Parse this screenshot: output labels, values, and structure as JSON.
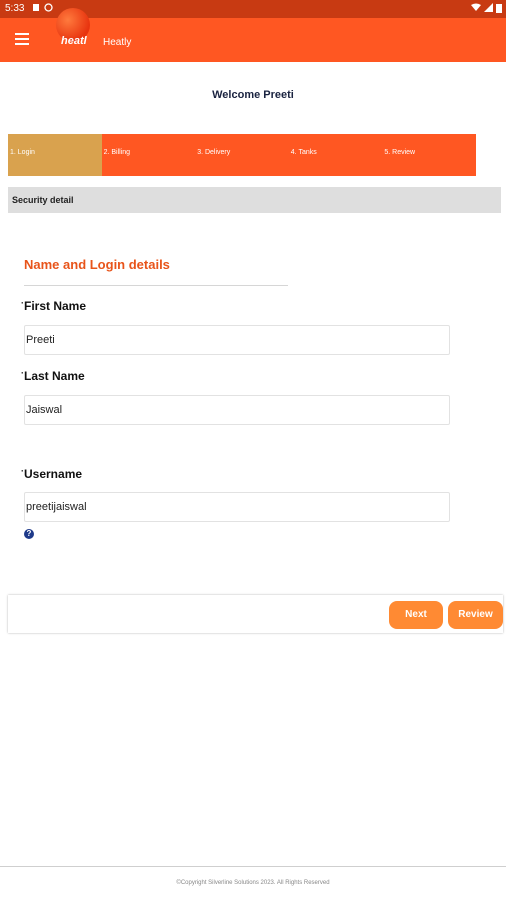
{
  "statusbar": {
    "time": "5:33"
  },
  "app": {
    "title": "Heatly",
    "logo_text": "heatl"
  },
  "welcome": "Welcome Preeti",
  "steps": [
    {
      "label": "1. Login"
    },
    {
      "label": "2. Billing"
    },
    {
      "label": "3. Delivery"
    },
    {
      "label": "4. Tanks"
    },
    {
      "label": "5. Review"
    }
  ],
  "section_bar": "Security detail",
  "section_title": "Name and Login details",
  "fields": {
    "first_name": {
      "label": "First Name",
      "value": "Preeti"
    },
    "last_name": {
      "label": "Last Name",
      "value": "Jaiswal"
    },
    "username": {
      "label": "Username",
      "value": "preetijaiswal"
    }
  },
  "help_icon": "?",
  "buttons": {
    "next": "Next",
    "review": "Review"
  },
  "footer": "©Copyright Silverline Solutions 2023. All Rights Reserved",
  "colors": {
    "primary": "#ff5722",
    "active_step": "#d9a24e",
    "button": "#ff8a33",
    "section_title": "#e8541a"
  }
}
